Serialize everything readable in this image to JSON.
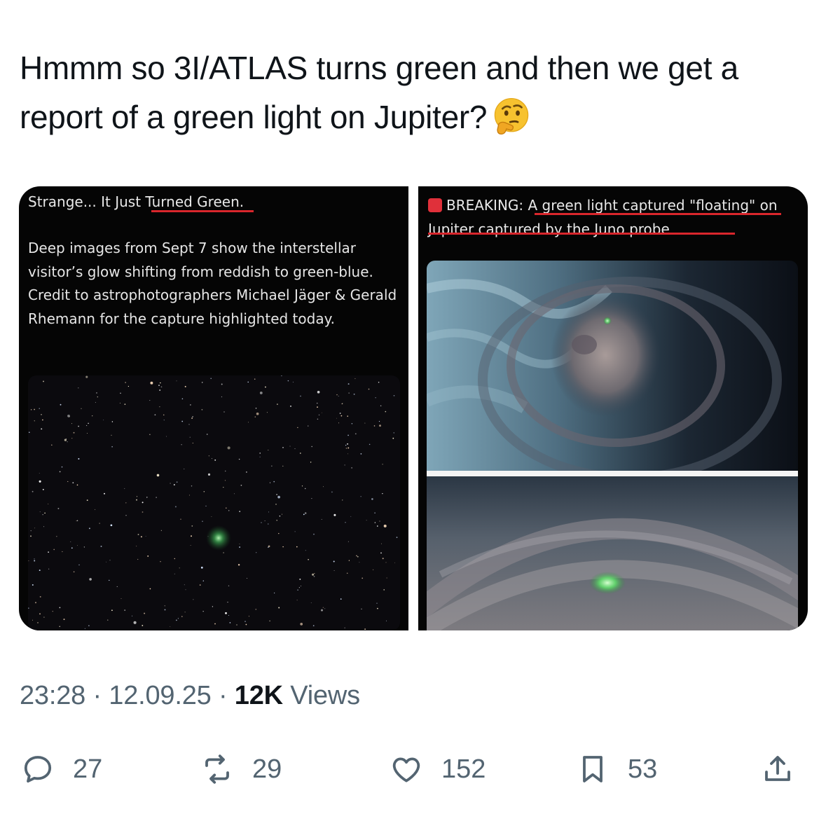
{
  "tweet": {
    "text": "Hmmm so 3I/ATLAS turns green and then we get a report of a green light on Jupiter?",
    "emoji": "thinking-face-emoji"
  },
  "media": {
    "left": {
      "title_prefix": "Strange... It Just ",
      "title_highlight": "Turned Green.",
      "body": "Deep images from Sept 7 show the interstellar visitor’s glow shifting from reddish to green-blue. Credit to astrophotographers Michael Jäger & Gerald Rhemann for the capture highlighted today."
    },
    "right": {
      "breaking_label": "BREAKING:",
      "headline": " A green light captured \"floating\" on Jupiter captured by the Juno probe"
    }
  },
  "meta": {
    "time": "23:28",
    "sep1": " · ",
    "date": "12.09.25",
    "sep2": " · ",
    "views_count": "12K",
    "views_label": " Views"
  },
  "actions": {
    "replies": "27",
    "reposts": "29",
    "likes": "152",
    "bookmarks": "53"
  },
  "colors": {
    "text": "#0f1419",
    "muted": "#536471",
    "underline": "#d9262c",
    "green_glow": "#6ee36e"
  }
}
